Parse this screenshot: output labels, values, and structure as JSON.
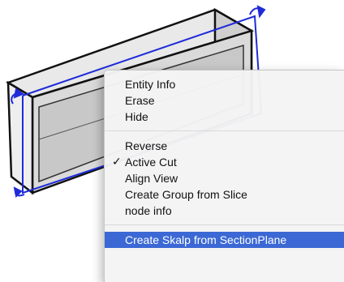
{
  "colors": {
    "section_plane": "#1f2bd9",
    "highlight": "#3b68d4",
    "box_face_front": "#d7d7d7",
    "box_face_top": "#e6e6e6",
    "box_inner": "#b9b9b9"
  },
  "viewport": {
    "description_icon": "section-plane-icon"
  },
  "context_menu": {
    "group1": [
      "Entity Info",
      "Erase",
      "Hide"
    ],
    "group2": [
      {
        "label": "Reverse",
        "checked": false
      },
      {
        "label": "Active Cut",
        "checked": true
      },
      {
        "label": "Align View",
        "checked": false
      },
      {
        "label": "Create Group from Slice",
        "checked": false
      },
      {
        "label": "node info",
        "checked": false
      }
    ],
    "check_mark": "✓",
    "highlighted_item": "Create Skalp from SectionPlane"
  }
}
